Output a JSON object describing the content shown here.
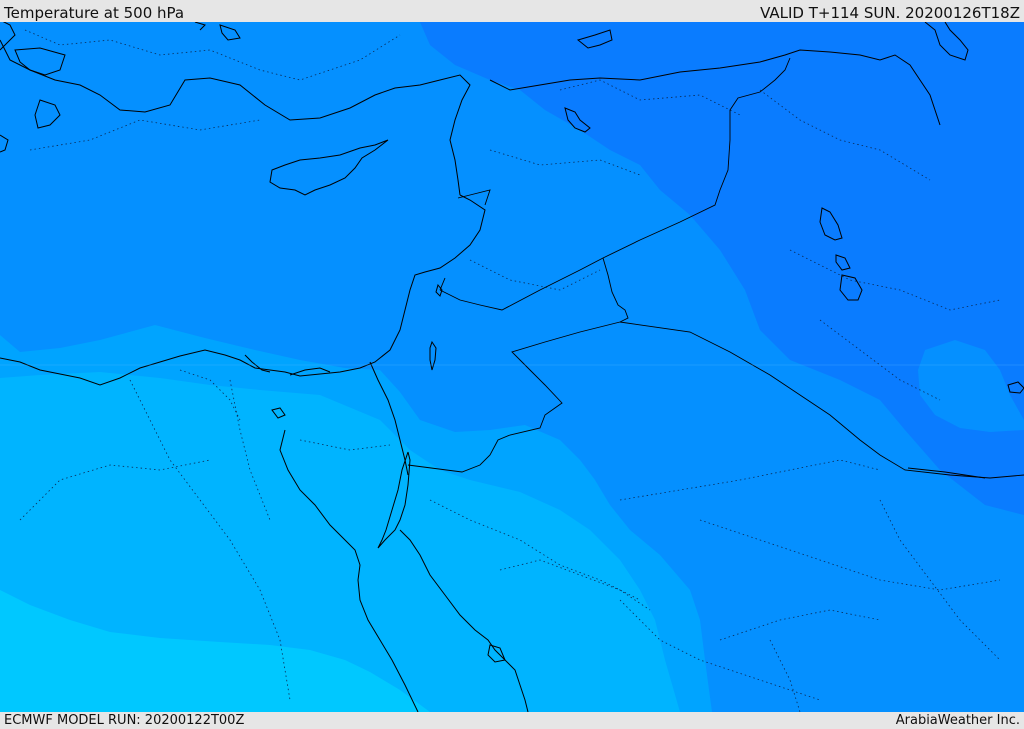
{
  "header": {
    "title": "Temperature at 500 hPa",
    "valid": "VALID T+114 SUN. 20200126T18Z"
  },
  "footer": {
    "model_run": "ECMWF MODEL RUN: 20200122T00Z",
    "credit": "ArabiaWeather Inc."
  },
  "colors": {
    "band_coldest": "#0a7cff",
    "band_cold": "#0590ff",
    "band_mid": "#00a4ff",
    "band_warm": "#00b4ff",
    "band_warmest": "#00c8ff",
    "coastline": "#000000",
    "bar_background": "#e6e6e6"
  }
}
